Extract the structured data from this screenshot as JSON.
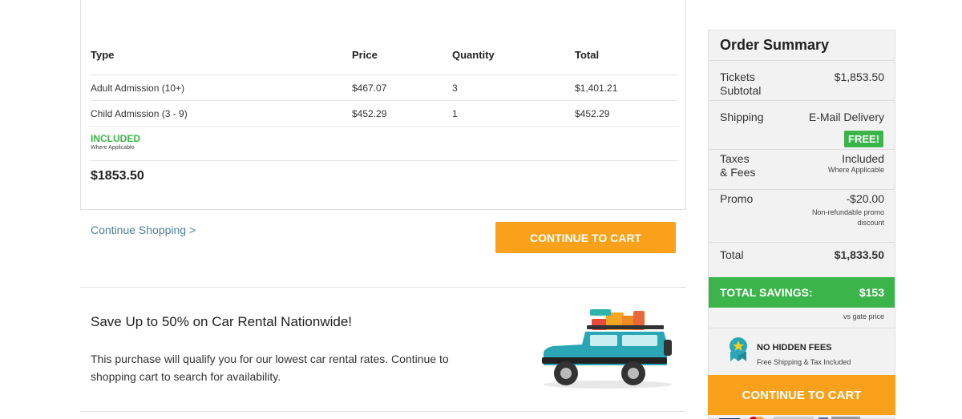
{
  "cart": {
    "headers": {
      "type": "Type",
      "price": "Price",
      "quantity": "Quantity",
      "total": "Total"
    },
    "items": [
      {
        "type": "Adult Admission (10+)",
        "price": "$467.07",
        "quantity": "3",
        "total": "$1,401.21"
      },
      {
        "type": "Child Admission (3 - 9)",
        "price": "$452.29",
        "quantity": "1",
        "total": "$452.29"
      }
    ],
    "included_label": "INCLUDED",
    "included_sub": "Where Applicable",
    "grand_total": "$1853.50"
  },
  "actions": {
    "continue_shopping": "Continue Shopping >",
    "continue_to_cart": "CONTINUE TO CART"
  },
  "promo": {
    "title": "Save Up to 50% on Car Rental Nationwide!",
    "text": "This purchase will qualify you for our lowest car rental rates. Continue to shopping cart to search for availability."
  },
  "summary": {
    "title": "Order Summary",
    "tickets_label_1": "Tickets",
    "tickets_label_2": "Subtotal",
    "tickets_value": "$1,853.50",
    "shipping_label": "Shipping",
    "shipping_value": "E-Mail Delivery",
    "shipping_badge": "FREE!",
    "taxes_label_1": "Taxes",
    "taxes_label_2": "& Fees",
    "taxes_value": "Included",
    "taxes_sub": "Where Applicable",
    "promo_label": "Promo",
    "promo_value": "-$20.00",
    "promo_sub_1": "Non-refundable promo",
    "promo_sub_2": "discount",
    "total_label": "Total",
    "total_value": "$1,833.50",
    "savings_label": "TOTAL SAVINGS:",
    "savings_value": "$153",
    "savings_sub": "vs gate price",
    "no_hidden_title": "NO HIDDEN FEES",
    "no_hidden_sub": "Free Shipping & Tax Included",
    "cta": "CONTINUE TO CART"
  },
  "colors": {
    "accent_orange": "#f9a11b",
    "success_green": "#3bb54a",
    "link_blue": "#4d7f99"
  }
}
